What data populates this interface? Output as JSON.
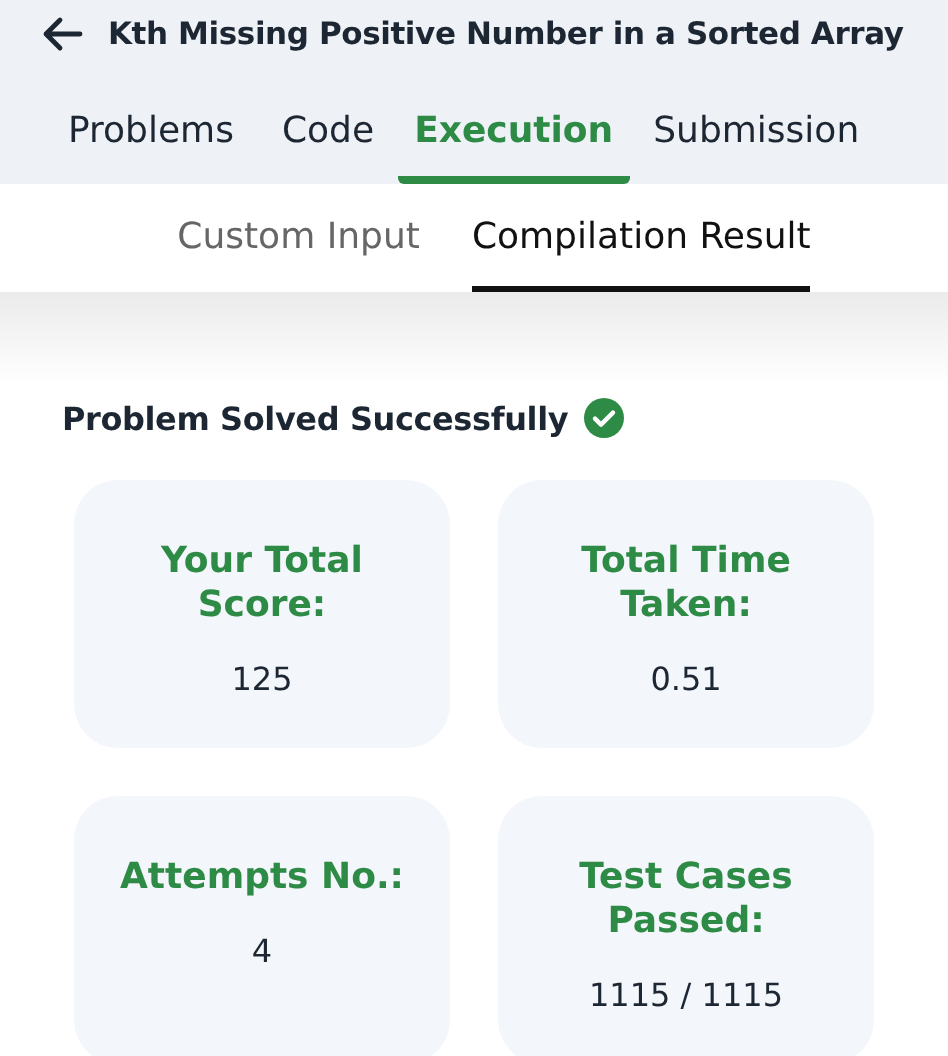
{
  "header": {
    "title": "Kth Missing Positive Number in a Sorted Array"
  },
  "tabs": [
    {
      "label": "Problems",
      "selected": false
    },
    {
      "label": "Code",
      "selected": false
    },
    {
      "label": "Execution",
      "selected": true
    },
    {
      "label": "Submission",
      "selected": false
    }
  ],
  "subtabs": [
    {
      "label": "Custom Input",
      "selected": false
    },
    {
      "label": "Compilation Result",
      "selected": true
    }
  ],
  "status": {
    "text": "Problem Solved Successfully",
    "success": true
  },
  "stats": [
    {
      "label": "Your Total Score:",
      "value": "125"
    },
    {
      "label": "Total Time Taken:",
      "value": "0.51"
    },
    {
      "label": "Attempts No.:",
      "value": "4"
    },
    {
      "label": "Test Cases Passed:",
      "value": "1115 / 1115"
    }
  ]
}
